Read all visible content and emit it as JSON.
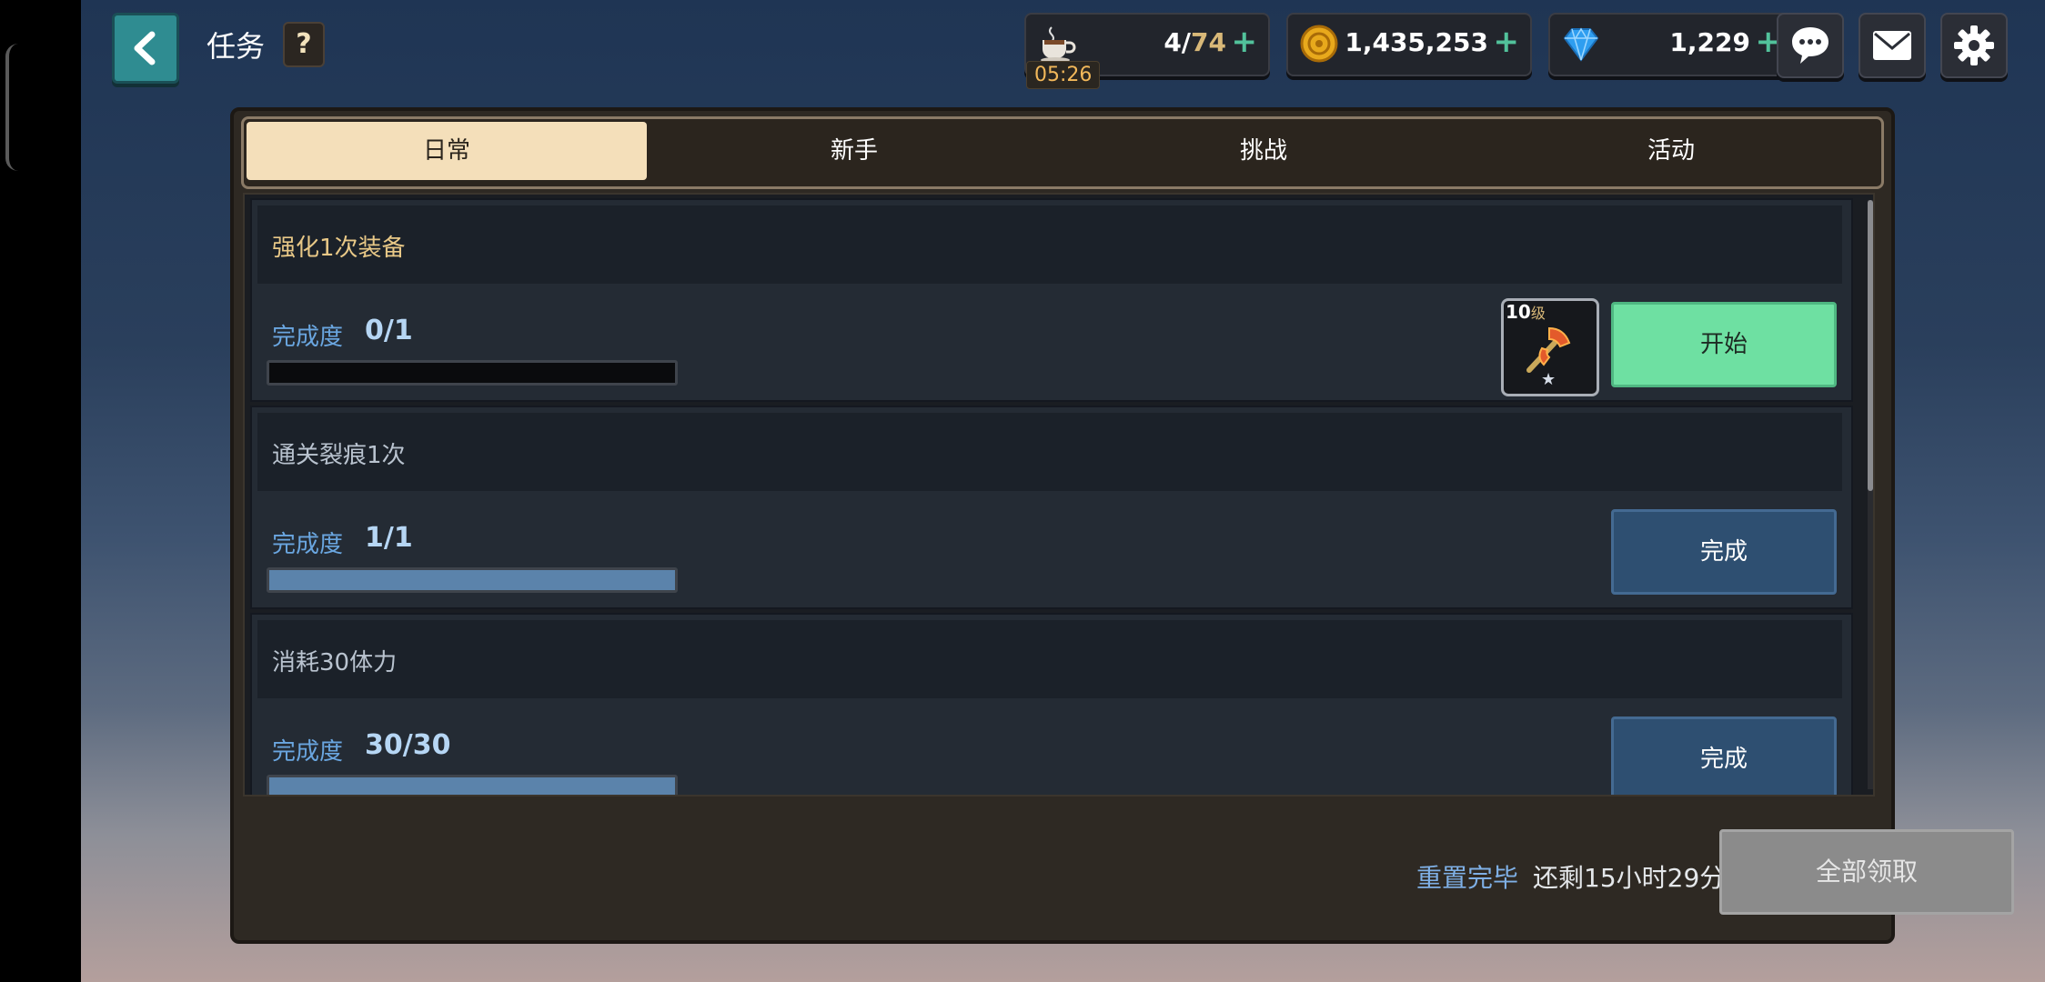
{
  "header": {
    "title": "任务",
    "help_label": "?"
  },
  "resources": {
    "stamina": {
      "current": "4/",
      "max": "74",
      "timer": "05:26",
      "icon": "coffee-cup-icon"
    },
    "gold": {
      "value": "1,435,253",
      "icon": "gold-coin-icon"
    },
    "gems": {
      "value": "1,229",
      "icon": "diamond-icon"
    },
    "plus_label": "+"
  },
  "tabs": [
    {
      "label": "日常",
      "active": true
    },
    {
      "label": "新手",
      "active": false
    },
    {
      "label": "挑战",
      "active": false
    },
    {
      "label": "活动",
      "active": false
    }
  ],
  "quests": [
    {
      "name": "强化1次装备",
      "progress_label": "完成度",
      "progress": "0/1",
      "fraction": 0,
      "reward": {
        "level": "10",
        "level_suffix": "级",
        "icon": "axe-icon",
        "star": "★"
      },
      "button": "开始",
      "button_state": "start"
    },
    {
      "name": "通关裂痕1次",
      "progress_label": "完成度",
      "progress": "1/1",
      "fraction": 1,
      "button": "完成",
      "button_state": "done"
    },
    {
      "name": "消耗30体力",
      "progress_label": "完成度",
      "progress": "30/30",
      "fraction": 1,
      "button": "完成",
      "button_state": "done"
    }
  ],
  "footer": {
    "status": "重置完毕",
    "time_remaining": "还剩15小时29分",
    "claim_all": "全部领取"
  },
  "colors": {
    "accent_green": "#6ee0a2",
    "done_blue": "#2e4f71",
    "tab_active": "#f4dfba"
  }
}
